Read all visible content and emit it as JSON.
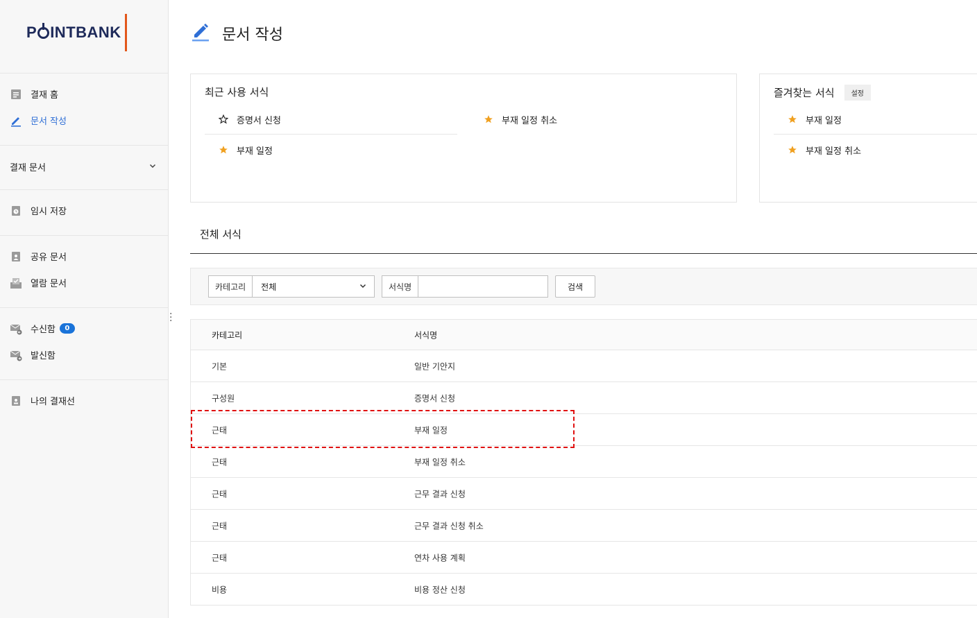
{
  "logo": {
    "text_pre": "P",
    "text_post": "INTBANK"
  },
  "page_title": "문서 작성",
  "sidebar": {
    "items": [
      {
        "label": "결재 홈",
        "icon": "document-home-icon"
      },
      {
        "label": "문서 작성",
        "icon": "pen-icon",
        "active": true
      },
      {
        "label": "임시 저장",
        "icon": "clock-doc-icon"
      },
      {
        "label": "공유 문서",
        "icon": "shared-doc-icon"
      },
      {
        "label": "열람 문서",
        "icon": "read-doc-icon"
      },
      {
        "label": "수신함",
        "icon": "inbox-icon",
        "badge": "0"
      },
      {
        "label": "발신함",
        "icon": "outbox-icon"
      },
      {
        "label": "나의 결재선",
        "icon": "approval-line-icon"
      }
    ],
    "group": {
      "label": "결재 문서"
    }
  },
  "recent": {
    "title": "최근 사용 서식",
    "items": [
      "증명서 신청",
      "부재 일정 취소",
      "부재 일정"
    ]
  },
  "favorites": {
    "title": "즐겨찾는 서식",
    "settings_label": "설정",
    "items": [
      "부재 일정",
      "부재 일정 취소"
    ]
  },
  "all_forms": {
    "title": "전체 서식"
  },
  "filter": {
    "category_label": "카테고리",
    "category_value": "전체",
    "name_label": "서식명",
    "name_value": "",
    "search_label": "검색"
  },
  "table": {
    "headers": [
      "카테고리",
      "서식명"
    ],
    "rows": [
      [
        "기본",
        "일반 기안지"
      ],
      [
        "구성원",
        "증명서 신청"
      ],
      [
        "근태",
        "부재 일정"
      ],
      [
        "근태",
        "부재 일정 취소"
      ],
      [
        "근태",
        "근무 결과 신청"
      ],
      [
        "근태",
        "근무 결과 신청 취소"
      ],
      [
        "근태",
        "연차 사용 계획"
      ],
      [
        "비용",
        "비용 정산 신청"
      ]
    ]
  },
  "colors": {
    "accent": "#2f6fd6",
    "star": "#f0a020",
    "logo_bar": "#e2571b",
    "highlight": "#e01010"
  }
}
